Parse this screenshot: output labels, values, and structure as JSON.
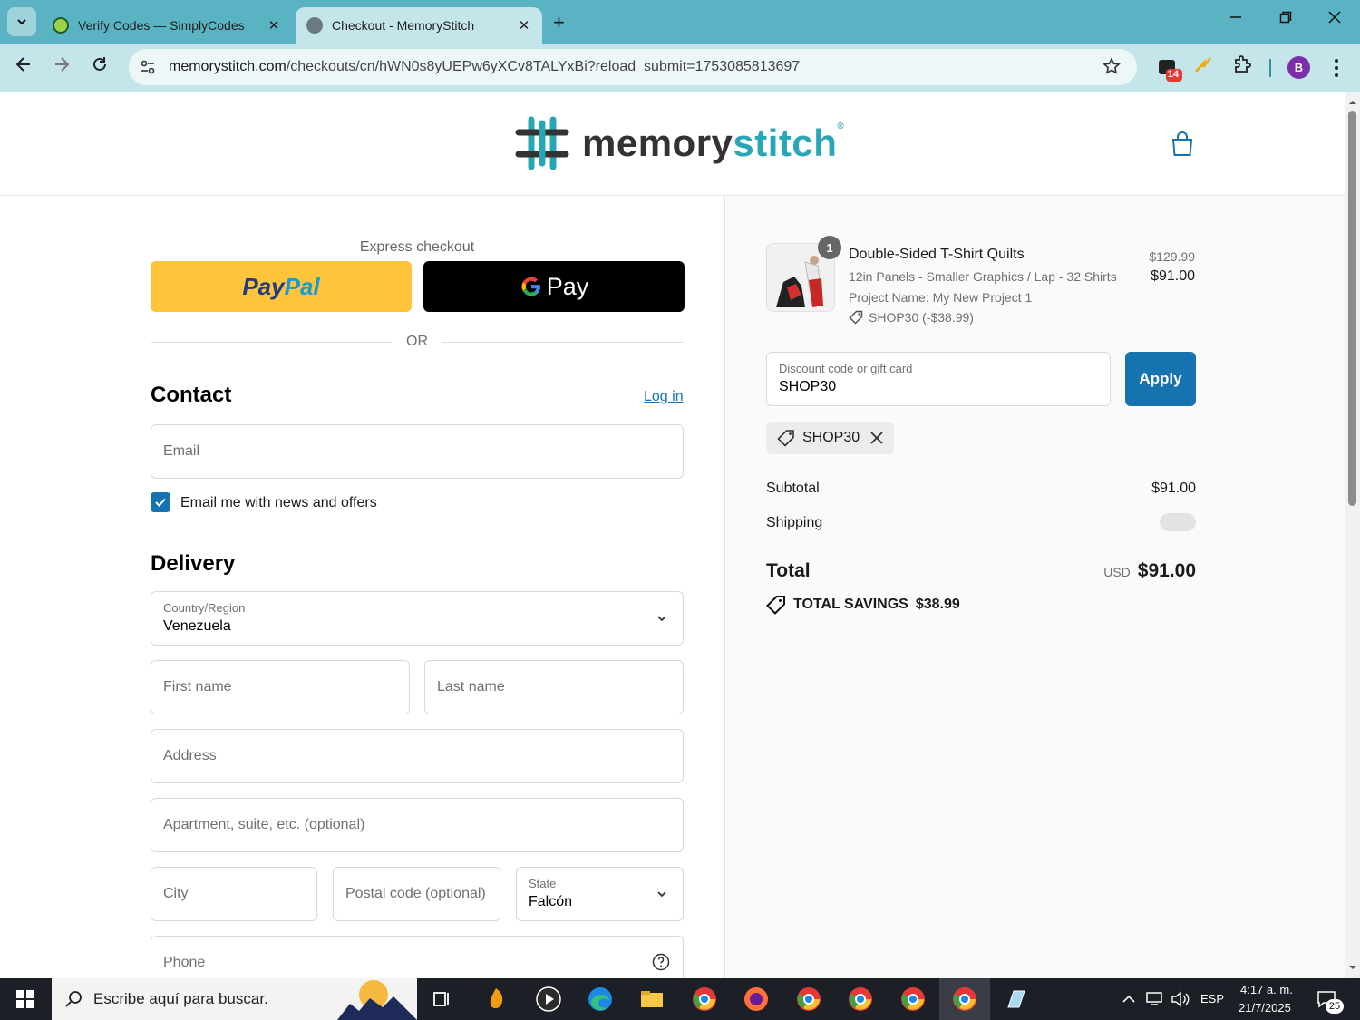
{
  "browser": {
    "tabs": [
      {
        "title": "Verify Codes — SimplyCodes",
        "active": false
      },
      {
        "title": "Checkout - MemoryStitch",
        "active": true
      }
    ],
    "url_domain": "memorystitch.com",
    "url_path": "/checkouts/cn/hWN0s8yUEPw6yXCv8TALYxBi?reload_submit=1753085813697",
    "ext_badge": "14",
    "profile_initial": "B",
    "close_glyph": "✕",
    "new_tab_glyph": "+"
  },
  "header": {
    "logo_part1": "memory",
    "logo_part2": "stitch",
    "logo_mark": "®"
  },
  "checkout": {
    "express_label": "Express checkout",
    "paypal_part1": "Pay",
    "paypal_part2": "Pal",
    "gpay_label": "Pay",
    "or_label": "OR",
    "contact_heading": "Contact",
    "login_link": "Log in",
    "email_placeholder": "Email",
    "newsletter_label": "Email me with news and offers",
    "newsletter_checked": true,
    "delivery_heading": "Delivery",
    "country_label": "Country/Region",
    "country_value": "Venezuela",
    "first_name_placeholder": "First name",
    "last_name_placeholder": "Last name",
    "address_placeholder": "Address",
    "apartment_placeholder": "Apartment, suite, etc. (optional)",
    "city_placeholder": "City",
    "postal_placeholder": "Postal code (optional)",
    "state_label": "State",
    "state_value": "Falcón",
    "phone_placeholder": "Phone"
  },
  "summary": {
    "item": {
      "quantity": "1",
      "name": "Double-Sided T-Shirt Quilts",
      "variant": "12in Panels - Smaller Graphics / Lap - 32 Shirts",
      "project": "Project Name: My New Project 1",
      "discount": "SHOP30 (-$38.99)",
      "original_price": "$129.99",
      "price": "$91.00"
    },
    "discount_label": "Discount code or gift card",
    "discount_value": "SHOP30",
    "apply_label": "Apply",
    "applied_code": "SHOP30",
    "subtotal_label": "Subtotal",
    "subtotal_value": "$91.00",
    "shipping_label": "Shipping",
    "total_label": "Total",
    "total_currency": "USD",
    "total_value": "$91.00",
    "savings_label": "TOTAL SAVINGS",
    "savings_value": "$38.99"
  },
  "taskbar": {
    "search_placeholder": "Escribe aquí para buscar.",
    "language": "ESP",
    "time": "4:17 a. m.",
    "date": "21/7/2025",
    "notification_count": "25"
  },
  "colors": {
    "accent": "#1773b0",
    "tab_strip": "#5ab3c2",
    "toolbar": "#c4e6eb",
    "brand_teal": "#27a7b6",
    "paypal_yellow": "#ffc439"
  }
}
